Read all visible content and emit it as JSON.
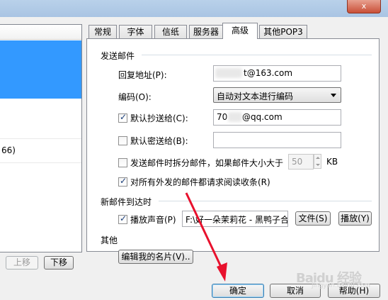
{
  "window": {
    "close_glyph": "x"
  },
  "left_panel": {
    "row_text": "66)",
    "up_button": "上移",
    "down_button": "下移"
  },
  "tabs": [
    {
      "label": "常规",
      "active": false
    },
    {
      "label": "字体",
      "active": false
    },
    {
      "label": "信纸",
      "active": false
    },
    {
      "label": "服务器",
      "active": false
    },
    {
      "label": "高级",
      "active": true
    },
    {
      "label": "其他POP3",
      "active": false
    }
  ],
  "send_section": {
    "title": "发送邮件",
    "reply_label": "回复地址(P):",
    "reply_value": "t@163.com",
    "encoding_label": "编码(O):",
    "encoding_value": "自动对文本进行编码",
    "cc_label": "默认抄送给(C):",
    "cc_checked": true,
    "cc_value_prefix": "70",
    "cc_value_suffix": "@qq.com",
    "bcc_label": "默认密送给(B):",
    "bcc_checked": false,
    "bcc_value": "",
    "split_label": "发送邮件时拆分邮件，如果邮件大小大于",
    "split_checked": false,
    "split_value": "50",
    "split_unit": "KB",
    "receipt_label": "对所有外发的邮件都请求阅读收条(R)",
    "receipt_checked": true
  },
  "arrive_section": {
    "title": "新邮件到达时",
    "sound_label": "播放声音(P)",
    "sound_checked": true,
    "sound_file": "F:\\好一朵茉莉花 - 黑鸭子合",
    "file_button": "文件(S)",
    "play_button": "播放(Y)"
  },
  "other_section": {
    "title": "其他",
    "edit_card_button": "编辑我的名片(V).."
  },
  "footer": {
    "ok_button": "确定",
    "cancel_button": "取消",
    "help_button": "帮助(H)"
  },
  "watermark": {
    "text": "Baidu 经验",
    "sub": "jingyan.baidu.com"
  },
  "colors": {
    "selection": "#3399ff",
    "arrow": "#e8112d",
    "dialog_bg": "#f0f0f0"
  },
  "icons": {
    "close": "close-icon",
    "check": "checkmark-icon",
    "dropdown": "chevron-down-icon"
  }
}
